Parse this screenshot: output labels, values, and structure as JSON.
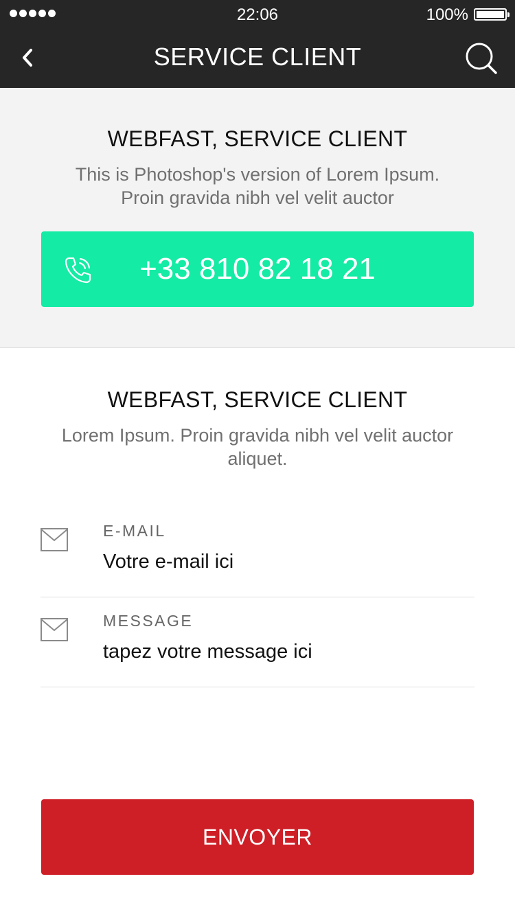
{
  "status_bar": {
    "time": "22:06",
    "battery_percent": "100%",
    "signal_dots": 5,
    "battery_level": 1.0
  },
  "nav": {
    "title": "SERVICE CLIENT",
    "back_icon": "chevron-left-icon",
    "search_icon": "search-icon"
  },
  "phone_section": {
    "title": "WEBFAST, SERVICE CLIENT",
    "description": "This is Photoshop's version  of Lorem Ipsum. Proin gravida nibh vel velit auctor",
    "phone_number": "+33 810 82 18 21",
    "phone_icon": "phone-icon",
    "accent_color": "#14eba4"
  },
  "contact_section": {
    "title": "WEBFAST, SERVICE CLIENT",
    "description": "Lorem Ipsum. Proin gravida nibh vel velit auctor aliquet.",
    "fields": [
      {
        "label": "E-MAIL",
        "placeholder": "Votre e-mail ici",
        "icon": "envelope-icon"
      },
      {
        "label": "MESSAGE",
        "placeholder": "tapez votre message ici",
        "icon": "envelope-icon"
      }
    ]
  },
  "send_button": {
    "label": "ENVOYER",
    "color": "#ce1f27"
  }
}
